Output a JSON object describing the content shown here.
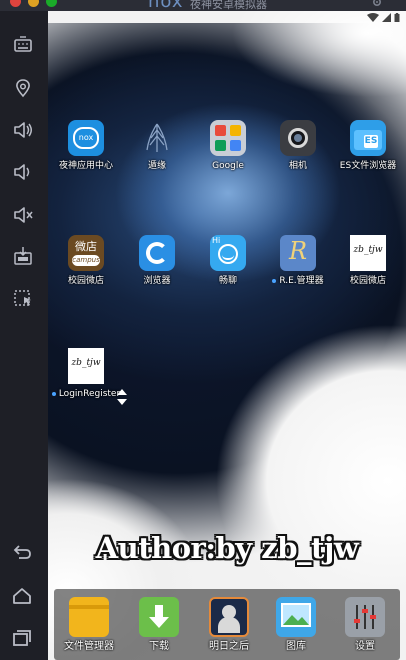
{
  "window": {
    "brand": "nox",
    "title": "夜神安卓模拟器"
  },
  "colors": {
    "accent": "#4aa3ff",
    "sidebar_bg": "#1e1f26",
    "titlebar_bg": "#2b2d36"
  },
  "sidebar": {
    "tools": [
      {
        "icon": "keyboard-icon"
      },
      {
        "icon": "location-pin-icon"
      },
      {
        "icon": "volume-up-icon"
      },
      {
        "icon": "volume-down-icon"
      },
      {
        "icon": "volume-mute-icon"
      },
      {
        "icon": "apk-install-icon"
      },
      {
        "icon": "screenshot-select-icon"
      }
    ],
    "nav": [
      {
        "icon": "back-icon"
      },
      {
        "icon": "home-icon"
      },
      {
        "icon": "recent-apps-icon"
      }
    ]
  },
  "home": {
    "row1": [
      {
        "label": "夜神应用中心",
        "icon": "nox-app-center-icon"
      },
      {
        "label": "遁缘",
        "icon": "dunyuan-feather-icon"
      },
      {
        "label": "Google",
        "icon": "google-folder-icon"
      },
      {
        "label": "相机",
        "icon": "camera-icon"
      },
      {
        "label": "ES文件浏览器",
        "icon": "es-file-explorer-icon"
      }
    ],
    "row2": [
      {
        "label": "校园微店",
        "icon": "campus-store-icon",
        "badge_text": "微店",
        "sub_text": "campus"
      },
      {
        "label": "浏览器",
        "icon": "browser-icon"
      },
      {
        "label": "畅聊",
        "icon": "chat-icon",
        "badge_text": "Hi"
      },
      {
        "label": "R.E.管理器",
        "icon": "re-manager-icon",
        "badge_text": "R"
      },
      {
        "label": "校园微店",
        "icon": "zb-tjw-icon",
        "badge_text": "zb_tjw"
      }
    ],
    "row3": [
      {
        "label": "LoginRegister",
        "icon": "zb-tjw-icon",
        "badge_text": "zb_tjw"
      }
    ]
  },
  "author_text": "Author:by zb_tjw",
  "dock": [
    {
      "label": "文件管理器",
      "icon": "file-manager-icon"
    },
    {
      "label": "下载",
      "icon": "download-icon"
    },
    {
      "label": "明日之后",
      "icon": "game-icon"
    },
    {
      "label": "图库",
      "icon": "gallery-icon"
    },
    {
      "label": "设置",
      "icon": "settings-icon"
    }
  ]
}
